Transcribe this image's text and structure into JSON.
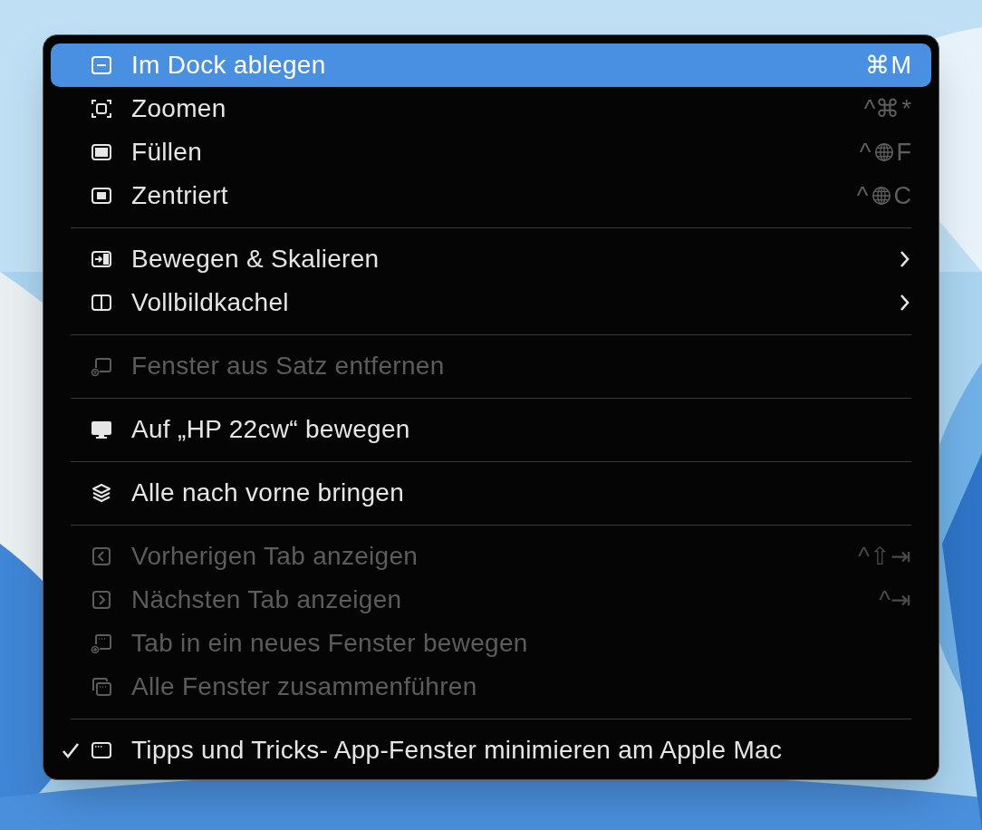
{
  "menu": {
    "sections": [
      {
        "items": [
          {
            "label": "Im Dock ablegen",
            "selected": true,
            "disabled": false,
            "checked": false,
            "shortcut": [
              {
                "kind": "text",
                "text": "⌘"
              },
              {
                "kind": "text",
                "text": "M"
              }
            ]
          },
          {
            "label": "Zoomen",
            "selected": false,
            "disabled": false,
            "checked": false,
            "shortcut": [
              {
                "kind": "text",
                "text": "^⌘"
              },
              {
                "kind": "text",
                "text": "*"
              }
            ]
          },
          {
            "label": "Füllen",
            "selected": false,
            "disabled": false,
            "checked": false,
            "shortcut": [
              {
                "kind": "text",
                "text": "^"
              },
              {
                "kind": "globe"
              },
              {
                "kind": "text",
                "text": "F"
              }
            ]
          },
          {
            "label": "Zentriert",
            "selected": false,
            "disabled": false,
            "checked": false,
            "shortcut": [
              {
                "kind": "text",
                "text": "^"
              },
              {
                "kind": "globe"
              },
              {
                "kind": "text",
                "text": "C"
              }
            ]
          }
        ]
      },
      {
        "items": [
          {
            "label": "Bewegen & Skalieren",
            "selected": false,
            "disabled": false,
            "checked": false,
            "submenu": true
          },
          {
            "label": "Vollbildkachel",
            "selected": false,
            "disabled": false,
            "checked": false,
            "submenu": true
          }
        ]
      },
      {
        "items": [
          {
            "label": "Fenster aus Satz entfernen",
            "selected": false,
            "disabled": true,
            "checked": false
          }
        ]
      },
      {
        "items": [
          {
            "label": "Auf „HP 22cw“ bewegen",
            "selected": false,
            "disabled": false,
            "checked": false
          }
        ]
      },
      {
        "items": [
          {
            "label": "Alle nach vorne bringen",
            "selected": false,
            "disabled": false,
            "checked": false
          }
        ]
      },
      {
        "items": [
          {
            "label": "Vorherigen Tab anzeigen",
            "selected": false,
            "disabled": true,
            "checked": false,
            "shortcut": [
              {
                "kind": "text",
                "text": "^⇧⇥"
              }
            ]
          },
          {
            "label": "Nächsten Tab anzeigen",
            "selected": false,
            "disabled": true,
            "checked": false,
            "shortcut": [
              {
                "kind": "text",
                "text": "^⇥"
              }
            ]
          },
          {
            "label": "Tab in ein neues Fenster bewegen",
            "selected": false,
            "disabled": true,
            "checked": false
          },
          {
            "label": "Alle Fenster zusammenführen",
            "selected": false,
            "disabled": true,
            "checked": false
          }
        ]
      },
      {
        "items": [
          {
            "label": "Tipps und Tricks- App-Fenster minimieren am Apple Mac",
            "selected": false,
            "disabled": false,
            "checked": true
          }
        ]
      }
    ]
  }
}
